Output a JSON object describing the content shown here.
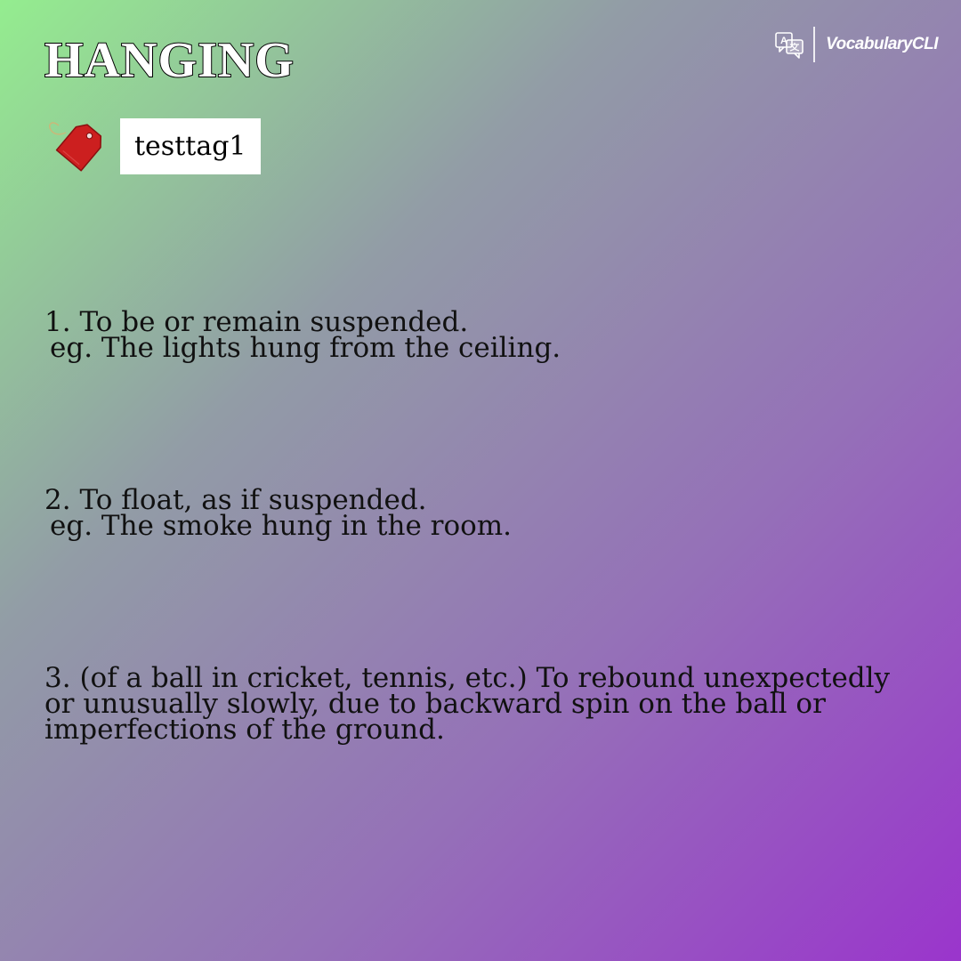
{
  "word": "HANGING",
  "tag": {
    "icon": "price-tag-icon",
    "label": "testtag1"
  },
  "brand": {
    "icon": "translate-icon",
    "name": "VocabularyCLI"
  },
  "definitions": [
    {
      "number": "1.",
      "text": "To be or remain suspended.",
      "example": "eg. The lights hung from the ceiling."
    },
    {
      "number": "2.",
      "text": "To float, as if suspended.",
      "example": "eg. The smoke hung in the room."
    },
    {
      "number": "3.",
      "text": "(of a ball in cricket, tennis, etc.) To rebound unexpectedly or unusually slowly, due to backward spin on the ball or imperfections of the ground.",
      "example": ""
    }
  ],
  "colors": {
    "gradient_start": "#94ed8f",
    "gradient_mid": "#929ca6",
    "gradient_end": "#9a35cc",
    "tag_red": "#cc1f1f",
    "title_fill": "#ffffff",
    "title_outline": "#000000"
  }
}
